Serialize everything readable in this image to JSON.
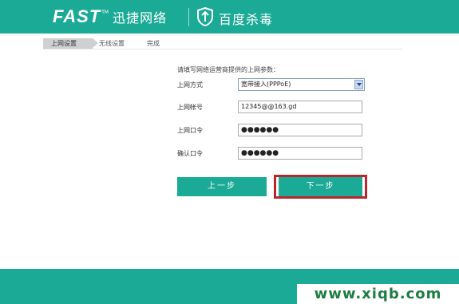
{
  "header": {
    "brand": "FAST",
    "brand_tm": "TM",
    "brand_cn": "迅捷网络",
    "partner": "百度杀毒"
  },
  "steps": [
    {
      "label": "上网设置",
      "active": true
    },
    {
      "label": "无线设置",
      "active": false
    },
    {
      "label": "完成",
      "active": false
    }
  ],
  "form": {
    "instruction": "请填写网络运营商提供的上网参数：",
    "connection_type_label": "上网方式",
    "connection_type_value": "宽带接入(PPPoE)",
    "account_label": "上网帐号",
    "account_value": "12345@@163.gd",
    "password_label": "上网口令",
    "password_value": "●●●●●●",
    "confirm_label": "确认口令",
    "confirm_value": "●●●●●●"
  },
  "buttons": {
    "prev": "上一步",
    "next": "下一步"
  },
  "watermark": "www.xiqb.com",
  "colors": {
    "brand_teal": "#1aaa96",
    "highlight_red": "#b8272d"
  }
}
